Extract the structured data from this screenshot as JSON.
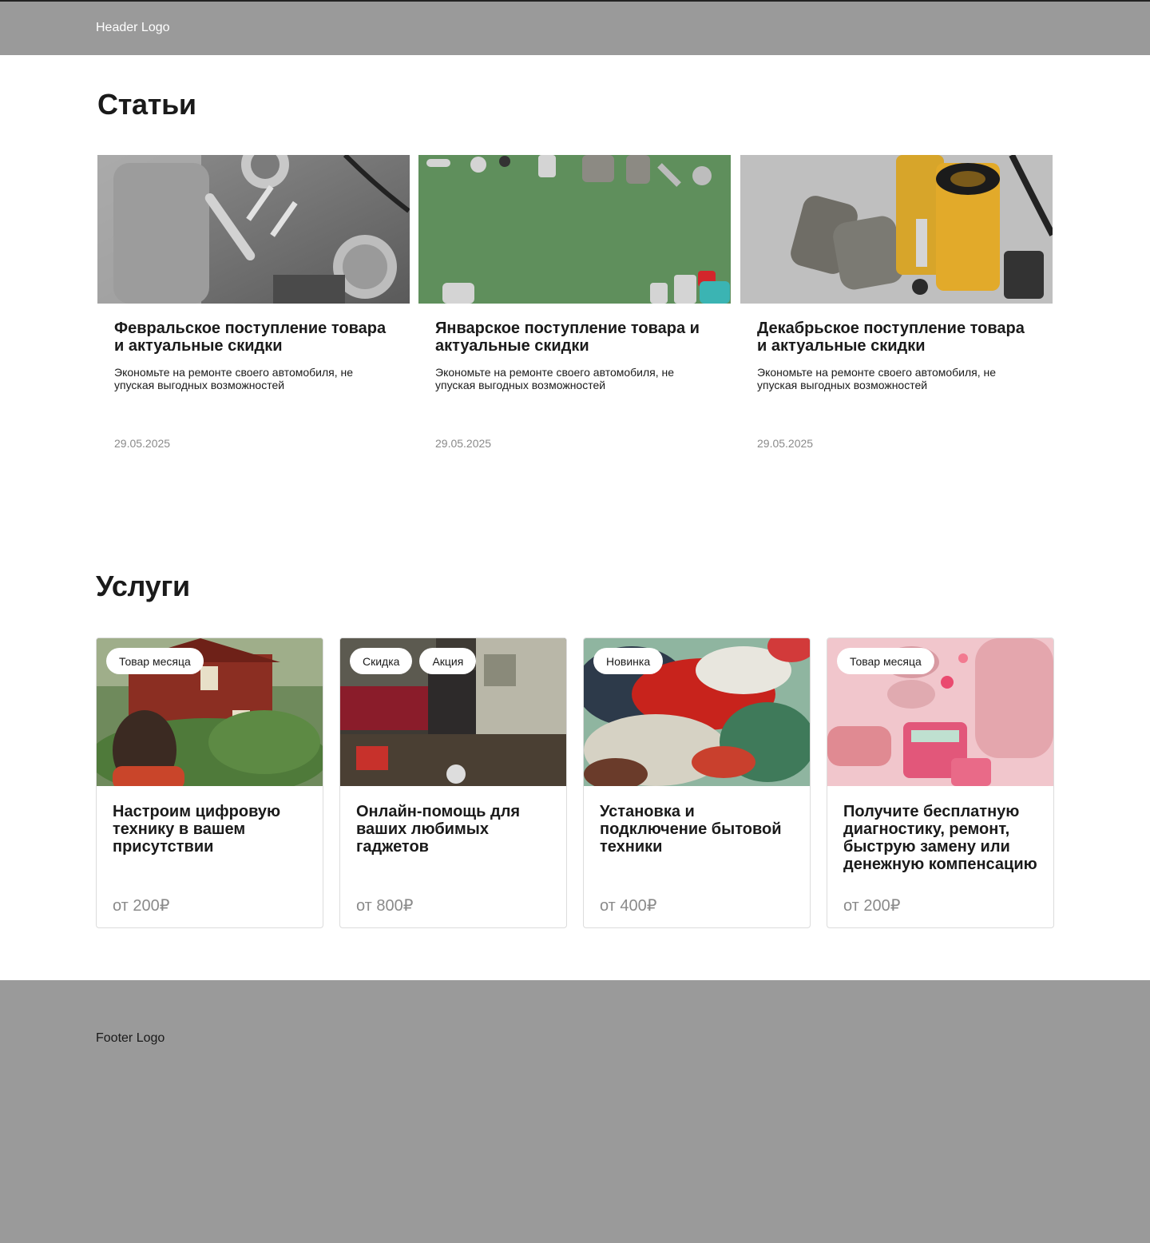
{
  "header": {
    "logo": "Header Logo"
  },
  "articles": {
    "title": "Статьи",
    "items": [
      {
        "title": "Февральское поступление товара и актуальные скидки",
        "description": "Экономьте на ремонте своего автомобиля, не упуская выгодных возможностей",
        "date": "29.05.2025"
      },
      {
        "title": "Январское поступление товара  и актуальные скидки",
        "description": "Экономьте на ремонте своего автомобиля, не упуская выгодных возможностей",
        "date": "29.05.2025"
      },
      {
        "title": "Декабрьское поступление товара и актуальные скидки",
        "description": "Экономьте на ремонте своего автомобиля, не упуская выгодных возможностей",
        "date": "29.05.2025"
      }
    ]
  },
  "services": {
    "title": "Услуги",
    "items": [
      {
        "tags": [
          "Товар месяца"
        ],
        "title": "Настроим цифровую технику в вашем присутствии",
        "price": "от 200₽"
      },
      {
        "tags": [
          "Скидка",
          "Акция"
        ],
        "title": "Онлайн-помощь для ваших любимых гаджетов",
        "price": "от 800₽"
      },
      {
        "tags": [
          "Новинка"
        ],
        "title": "Установка и подключение бытовой техники",
        "price": "от 400₽"
      },
      {
        "tags": [
          "Товар месяца"
        ],
        "title": "Получите бесплатную диагностику, ремонт, быструю замену или денежную компенсацию",
        "price": "от 200₽"
      }
    ]
  },
  "footer": {
    "logo": "Footer Logo"
  }
}
